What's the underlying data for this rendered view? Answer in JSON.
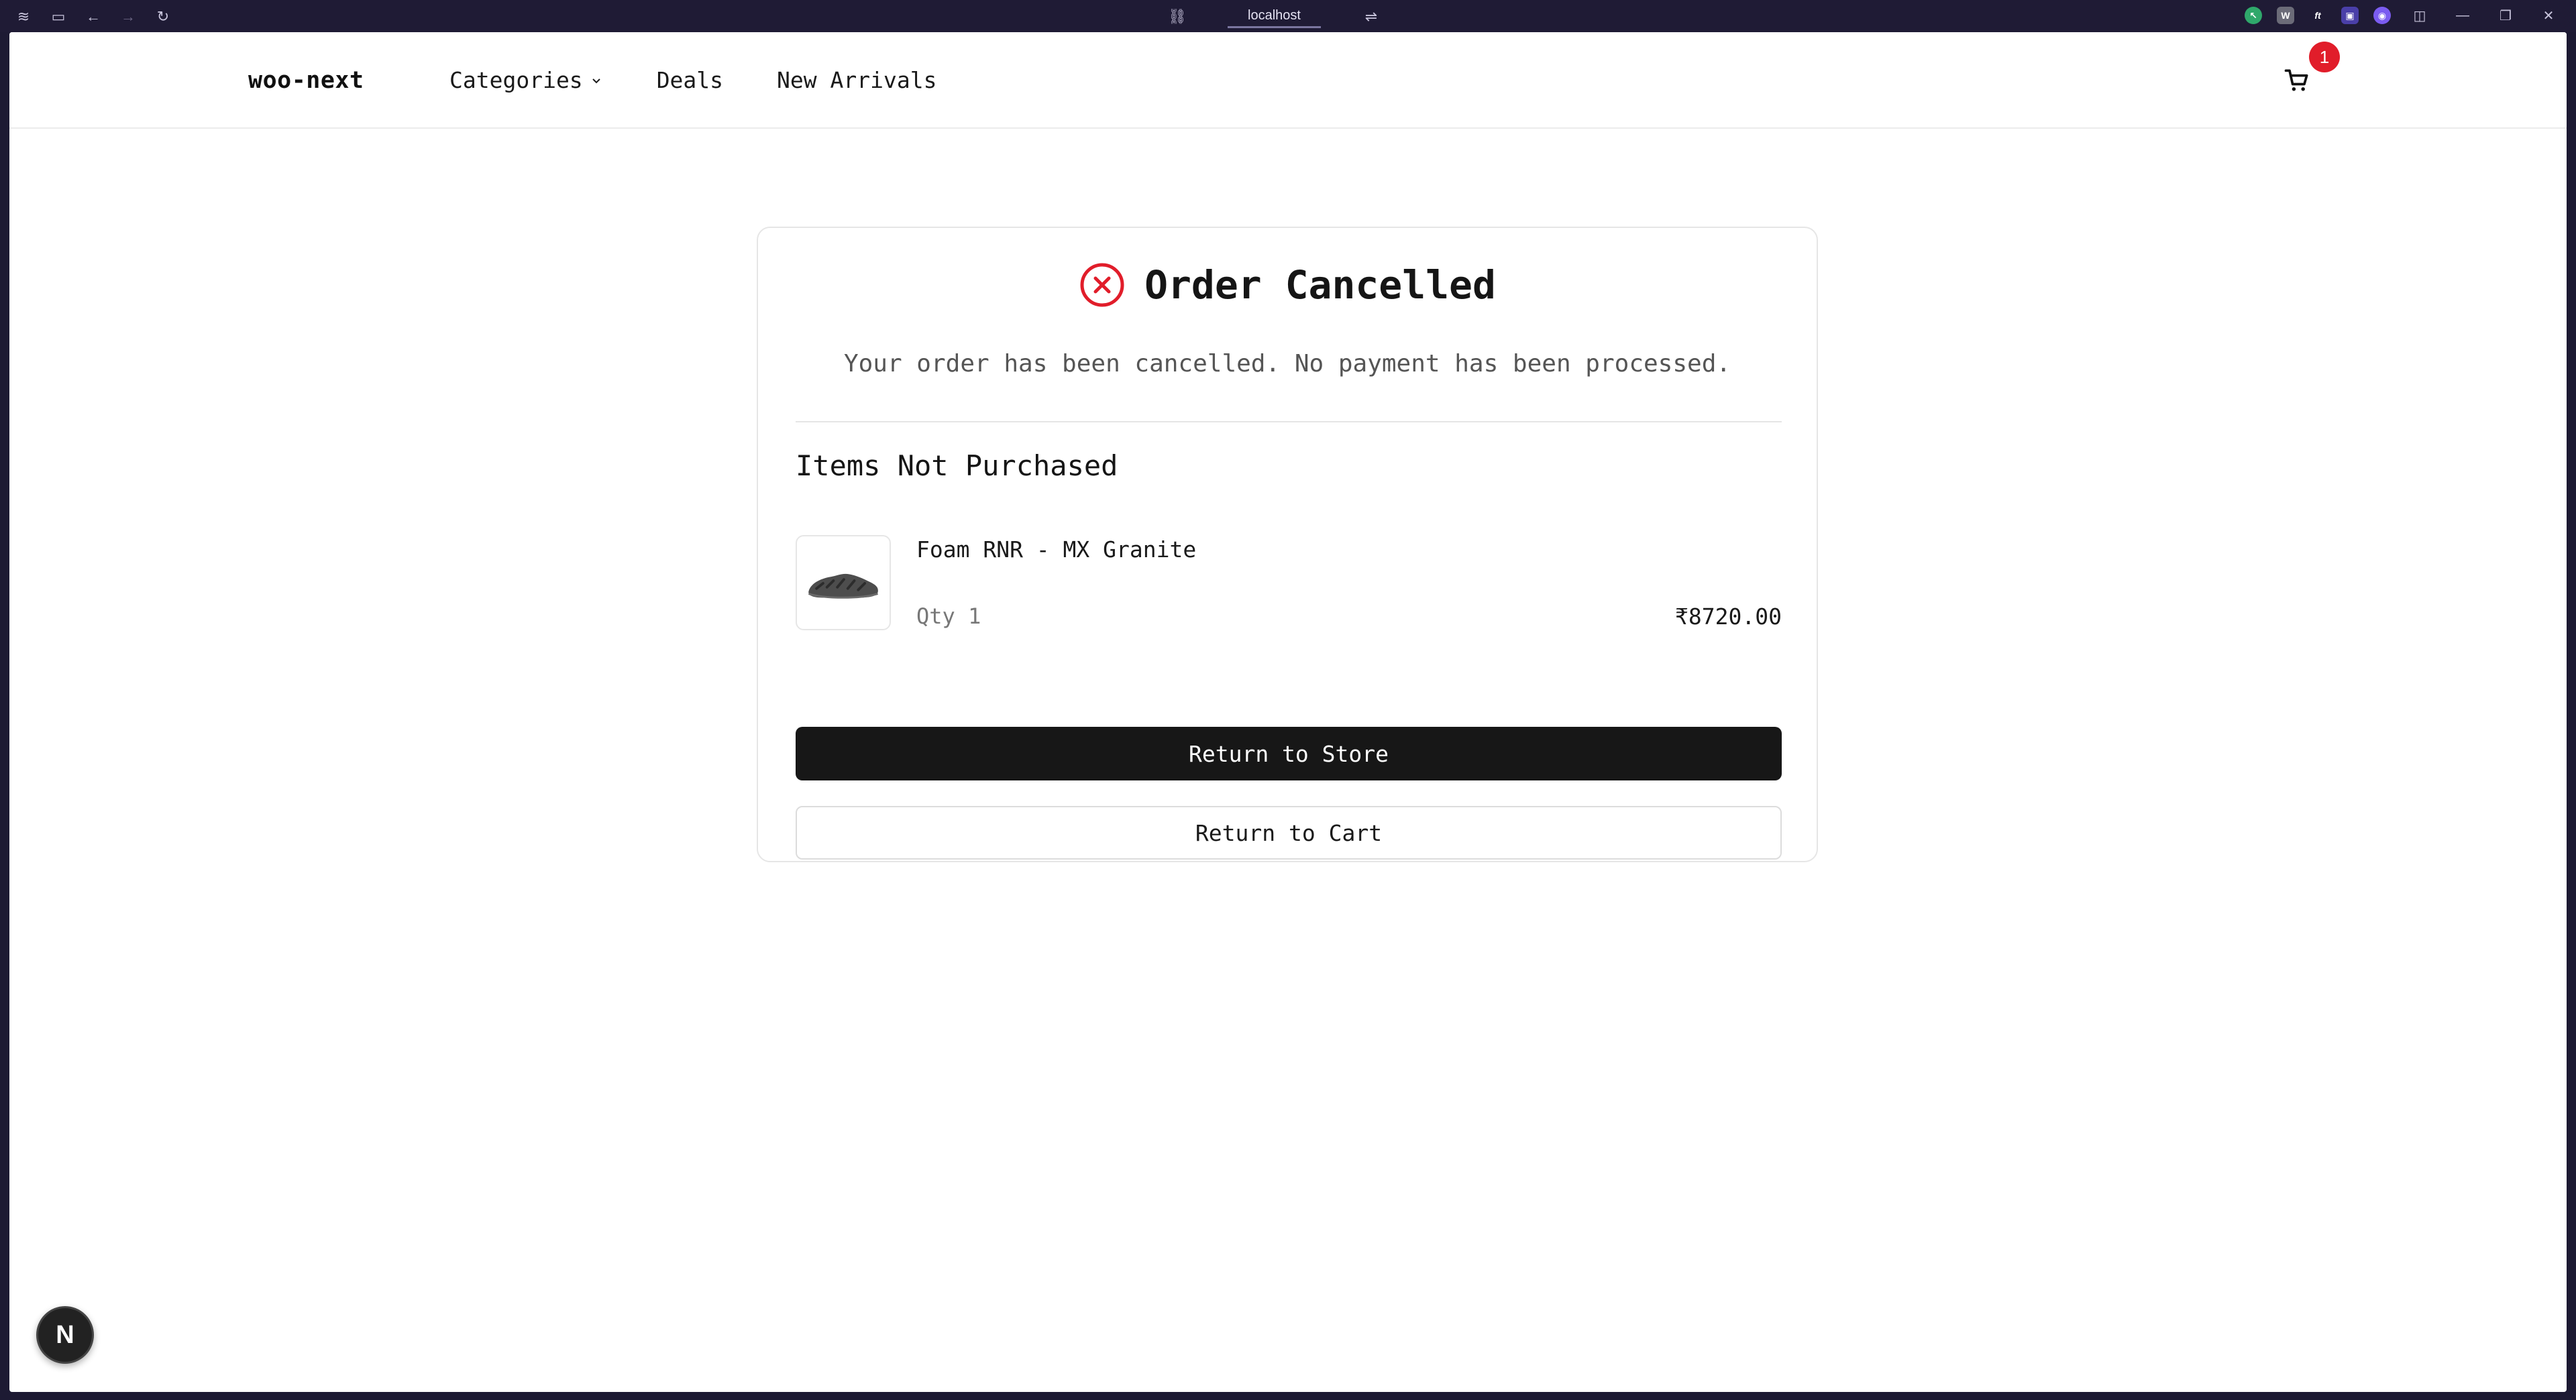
{
  "browser": {
    "url": "localhost"
  },
  "header": {
    "logo": "woo-next",
    "nav": [
      {
        "label": "Categories",
        "has_dropdown": true
      },
      {
        "label": "Deals"
      },
      {
        "label": "New Arrivals"
      }
    ],
    "cart_count": "1"
  },
  "order": {
    "title": "Order Cancelled",
    "message": "Your order has been cancelled. No payment has been processed.",
    "section_title": "Items Not Purchased",
    "items": [
      {
        "name": "Foam RNR - MX Granite",
        "qty_label": "Qty 1",
        "price": "₹8720.00"
      }
    ],
    "primary_button": "Return to Store",
    "secondary_button": "Return to Cart"
  },
  "dev_badge": "N",
  "colors": {
    "accent_error": "#e11d2a",
    "primary_button_bg": "#171717",
    "chrome_bg": "#1f1b35"
  }
}
